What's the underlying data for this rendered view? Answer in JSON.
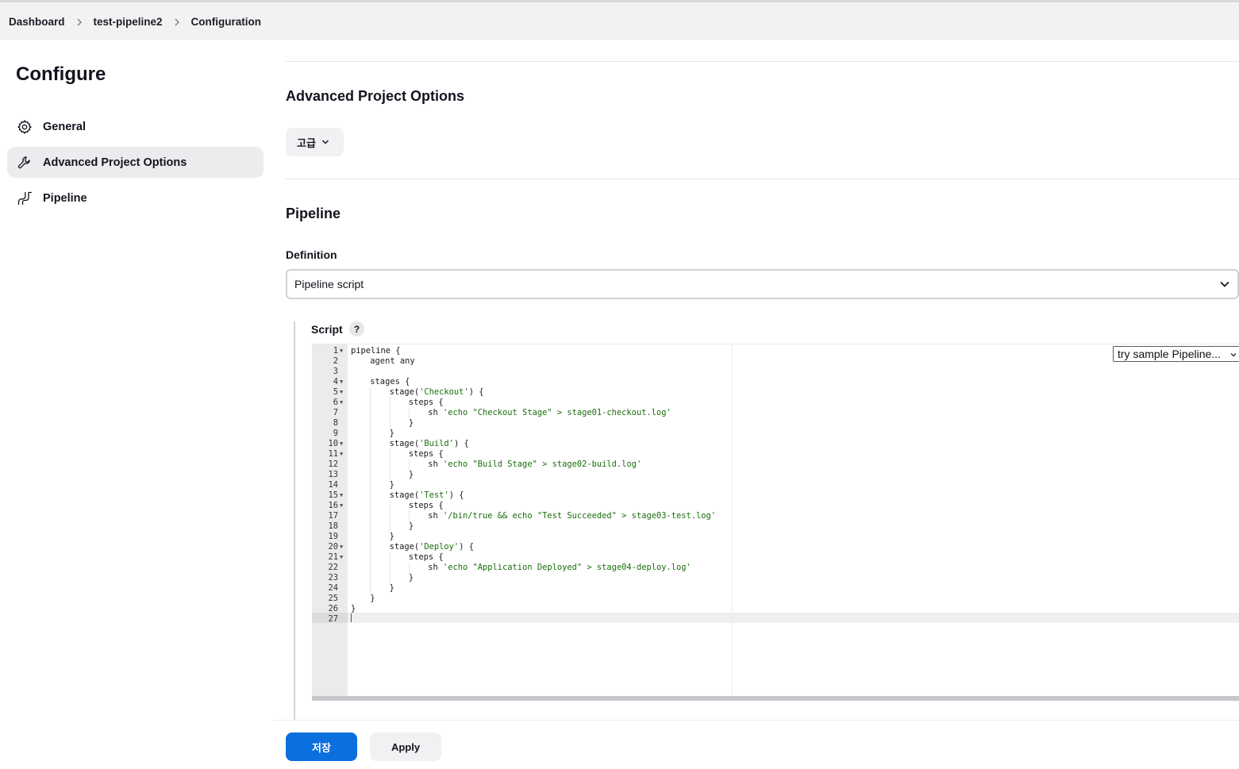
{
  "breadcrumb": [
    "Dashboard",
    "test-pipeline2",
    "Configuration"
  ],
  "sidebar": {
    "title": "Configure",
    "items": [
      {
        "label": "General",
        "icon": "gear-icon",
        "active": false
      },
      {
        "label": "Advanced Project Options",
        "icon": "wrench-icon",
        "active": true
      },
      {
        "label": "Pipeline",
        "icon": "pipeline-icon",
        "active": false
      }
    ]
  },
  "advanced": {
    "title": "Advanced Project Options",
    "button_label": "고급"
  },
  "pipeline": {
    "title": "Pipeline",
    "definition_label": "Definition",
    "definition_value": "Pipeline script",
    "script_label": "Script",
    "help_label": "?",
    "sample_select": "try sample Pipeline..."
  },
  "editor": {
    "active_line": 27,
    "lines": [
      {
        "n": "1",
        "fold": true,
        "indent": 0,
        "code": "pipeline {",
        "str": ""
      },
      {
        "n": "2",
        "fold": false,
        "indent": 1,
        "code": "agent any",
        "str": ""
      },
      {
        "n": "3",
        "fold": false,
        "indent": 0,
        "code": "",
        "str": ""
      },
      {
        "n": "4",
        "fold": true,
        "indent": 1,
        "code": "stages {",
        "str": ""
      },
      {
        "n": "5",
        "fold": true,
        "indent": 2,
        "code": "stage(",
        "str": "'Checkout'",
        "tail": ") {"
      },
      {
        "n": "6",
        "fold": true,
        "indent": 3,
        "code": "steps {",
        "str": ""
      },
      {
        "n": "7",
        "fold": false,
        "indent": 4,
        "code": "sh ",
        "str": "'echo \"Checkout Stage\" > stage01-checkout.log'"
      },
      {
        "n": "8",
        "fold": false,
        "indent": 3,
        "code": "}",
        "str": ""
      },
      {
        "n": "9",
        "fold": false,
        "indent": 2,
        "code": "}",
        "str": ""
      },
      {
        "n": "10",
        "fold": true,
        "indent": 2,
        "code": "stage(",
        "str": "'Build'",
        "tail": ") {"
      },
      {
        "n": "11",
        "fold": true,
        "indent": 3,
        "code": "steps {",
        "str": ""
      },
      {
        "n": "12",
        "fold": false,
        "indent": 4,
        "code": "sh ",
        "str": "'echo \"Build Stage\" > stage02-build.log'"
      },
      {
        "n": "13",
        "fold": false,
        "indent": 3,
        "code": "}",
        "str": ""
      },
      {
        "n": "14",
        "fold": false,
        "indent": 2,
        "code": "}",
        "str": ""
      },
      {
        "n": "15",
        "fold": true,
        "indent": 2,
        "code": "stage(",
        "str": "'Test'",
        "tail": ") {"
      },
      {
        "n": "16",
        "fold": true,
        "indent": 3,
        "code": "steps {",
        "str": ""
      },
      {
        "n": "17",
        "fold": false,
        "indent": 4,
        "code": "sh ",
        "str": "'/bin/true && echo \"Test Succeeded\" > stage03-test.log'"
      },
      {
        "n": "18",
        "fold": false,
        "indent": 3,
        "code": "}",
        "str": ""
      },
      {
        "n": "19",
        "fold": false,
        "indent": 2,
        "code": "}",
        "str": ""
      },
      {
        "n": "20",
        "fold": true,
        "indent": 2,
        "code": "stage(",
        "str": "'Deploy'",
        "tail": ") {"
      },
      {
        "n": "21",
        "fold": true,
        "indent": 3,
        "code": "steps {",
        "str": ""
      },
      {
        "n": "22",
        "fold": false,
        "indent": 4,
        "code": "sh ",
        "str": "'echo \"Application Deployed\" > stage04-deploy.log'"
      },
      {
        "n": "23",
        "fold": false,
        "indent": 3,
        "code": "}",
        "str": ""
      },
      {
        "n": "24",
        "fold": false,
        "indent": 2,
        "code": "}",
        "str": ""
      },
      {
        "n": "25",
        "fold": false,
        "indent": 1,
        "code": "}",
        "str": ""
      },
      {
        "n": "26",
        "fold": false,
        "indent": 0,
        "code": "}",
        "str": ""
      },
      {
        "n": "27",
        "fold": false,
        "indent": 0,
        "code": "",
        "str": ""
      }
    ]
  },
  "buttons": {
    "save_label": "저장",
    "apply_label": "Apply"
  },
  "colors": {
    "primary": "#0b6fdd",
    "string": "#1a6d0c",
    "active_nav": "#ececef"
  }
}
